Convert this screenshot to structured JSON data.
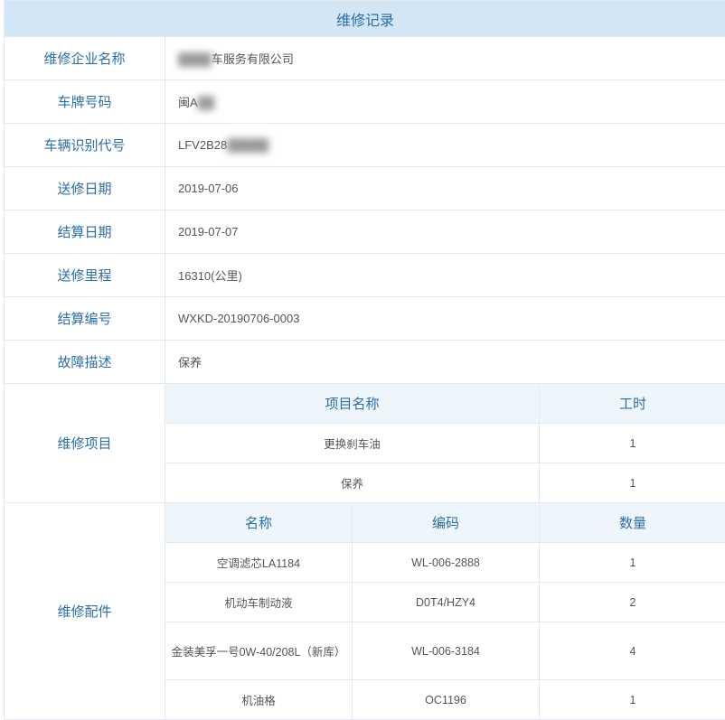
{
  "title": "维修记录",
  "rows": {
    "company": {
      "label": "维修企业名称",
      "value": "车服务有限公司",
      "redacted_prefix": "████ "
    },
    "plate": {
      "label": "车牌号码",
      "value": "闽A",
      "redacted_suffix": " ██"
    },
    "vin": {
      "label": "车辆识别代号",
      "value": "LFV2B28",
      "redacted_suffix": "█████"
    },
    "in_date": {
      "label": "送修日期",
      "value": "2019-07-06"
    },
    "out_date": {
      "label": "结算日期",
      "value": "2019-07-07"
    },
    "mileage": {
      "label": "送修里程",
      "value": "16310(公里)"
    },
    "bill_no": {
      "label": "结算编号",
      "value": "WXKD-20190706-0003"
    },
    "fault": {
      "label": "故障描述",
      "value": "保养"
    }
  },
  "repair_items": {
    "section_label": "维修项目",
    "headers": {
      "name": "项目名称",
      "hours": "工时"
    },
    "rows": [
      {
        "name": "更换刹车油",
        "hours": "1"
      },
      {
        "name": "保养",
        "hours": "1"
      }
    ]
  },
  "repair_parts": {
    "section_label": "维修配件",
    "headers": {
      "name": "名称",
      "code": "编码",
      "qty": "数量"
    },
    "rows": [
      {
        "name": "空调滤芯LA1184",
        "code": "WL-006-2888",
        "qty": "1"
      },
      {
        "name": "机动车制动液",
        "code": "D0T4/HZY4",
        "qty": "2"
      },
      {
        "name": "金装美孚一号0W-40/208L（新库）",
        "code": "WL-006-3184",
        "qty": "4",
        "tall": true
      },
      {
        "name": "机油格",
        "code": "OC1196",
        "qty": "1"
      }
    ]
  }
}
